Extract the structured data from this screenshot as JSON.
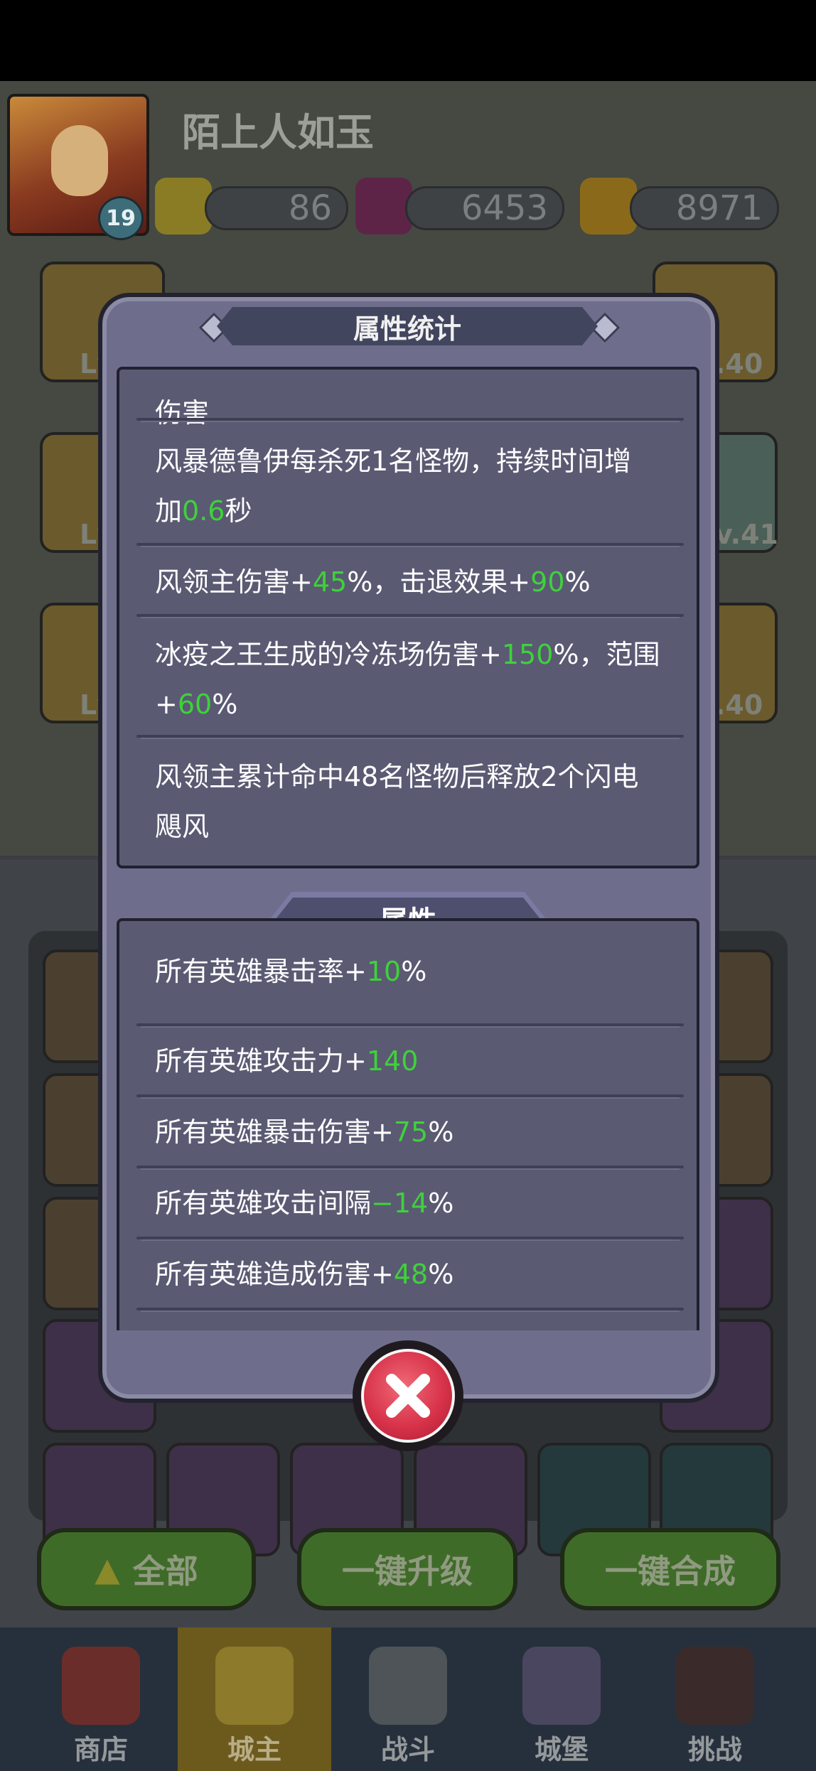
{
  "player": {
    "name": "陌上人如玉",
    "level": "19"
  },
  "resources": [
    {
      "icon": "gold-gem-plus-icon",
      "value": "86"
    },
    {
      "icon": "purple-gem-plus-icon",
      "value": "6453"
    },
    {
      "icon": "gold-coin-plus-icon",
      "value": "8971"
    }
  ],
  "side_cards": {
    "left": [
      "Lv",
      "Lv",
      "Lv"
    ],
    "right": [
      ".40",
      "v.41",
      ".40"
    ]
  },
  "modal": {
    "title": "属性统计",
    "stats_rows": [
      {
        "parts": [
          {
            "t": "伤害"
          }
        ]
      },
      {
        "line1": [
          {
            "t": "风暴德鲁伊每杀死1名怪物，持续时间增"
          }
        ],
        "line2": [
          {
            "t": "加"
          },
          {
            "t": "0.6",
            "g": true
          },
          {
            "t": "秒"
          }
        ]
      },
      {
        "parts": [
          {
            "t": "风领主伤害+"
          },
          {
            "t": "45",
            "g": true
          },
          {
            "t": "%，击退效果+"
          },
          {
            "t": "90",
            "g": true
          },
          {
            "t": "%"
          }
        ]
      },
      {
        "line1": [
          {
            "t": "冰疫之王生成的冷冻场伤害+"
          },
          {
            "t": "150",
            "g": true
          },
          {
            "t": "%，范围"
          }
        ],
        "line2": [
          {
            "t": "+"
          },
          {
            "t": "60",
            "g": true
          },
          {
            "t": "%"
          }
        ]
      },
      {
        "line1": [
          {
            "t": "风领主累计命中48名怪物后释放2个闪电"
          }
        ],
        "line2": [
          {
            "t": "飓风"
          }
        ]
      }
    ],
    "attributes_header": "属性",
    "attribute_rows": [
      [
        {
          "t": "所有英雄暴击率+"
        },
        {
          "t": "10",
          "g": true
        },
        {
          "t": "%"
        }
      ],
      [
        {
          "t": "所有英雄攻击力+"
        },
        {
          "t": "140",
          "g": true
        }
      ],
      [
        {
          "t": "所有英雄暴击伤害+"
        },
        {
          "t": "75",
          "g": true
        },
        {
          "t": "%"
        }
      ],
      [
        {
          "t": "所有英雄攻击间隔"
        },
        {
          "t": "−14",
          "g": true
        },
        {
          "t": "%"
        }
      ],
      [
        {
          "t": "所有英雄造成伤害+"
        },
        {
          "t": "48",
          "g": true
        },
        {
          "t": "%"
        }
      ]
    ]
  },
  "actions": {
    "all": "全部",
    "upgrade": "一键升级",
    "merge": "一键合成"
  },
  "nav": [
    {
      "label": "商店",
      "icon": "shop-icon",
      "active": false
    },
    {
      "label": "城主",
      "icon": "crown-icon",
      "active": true
    },
    {
      "label": "战斗",
      "icon": "crossed-swords-icon",
      "active": false
    },
    {
      "label": "城堡",
      "icon": "castle-icon",
      "active": false
    },
    {
      "label": "挑战",
      "icon": "demon-mask-icon",
      "active": false
    }
  ],
  "colors": {
    "highlight_green": "#3fd13b",
    "modal_bg": "#6e6e8c",
    "panel_bg": "#5a5a73",
    "close_red": "#d8334a"
  }
}
